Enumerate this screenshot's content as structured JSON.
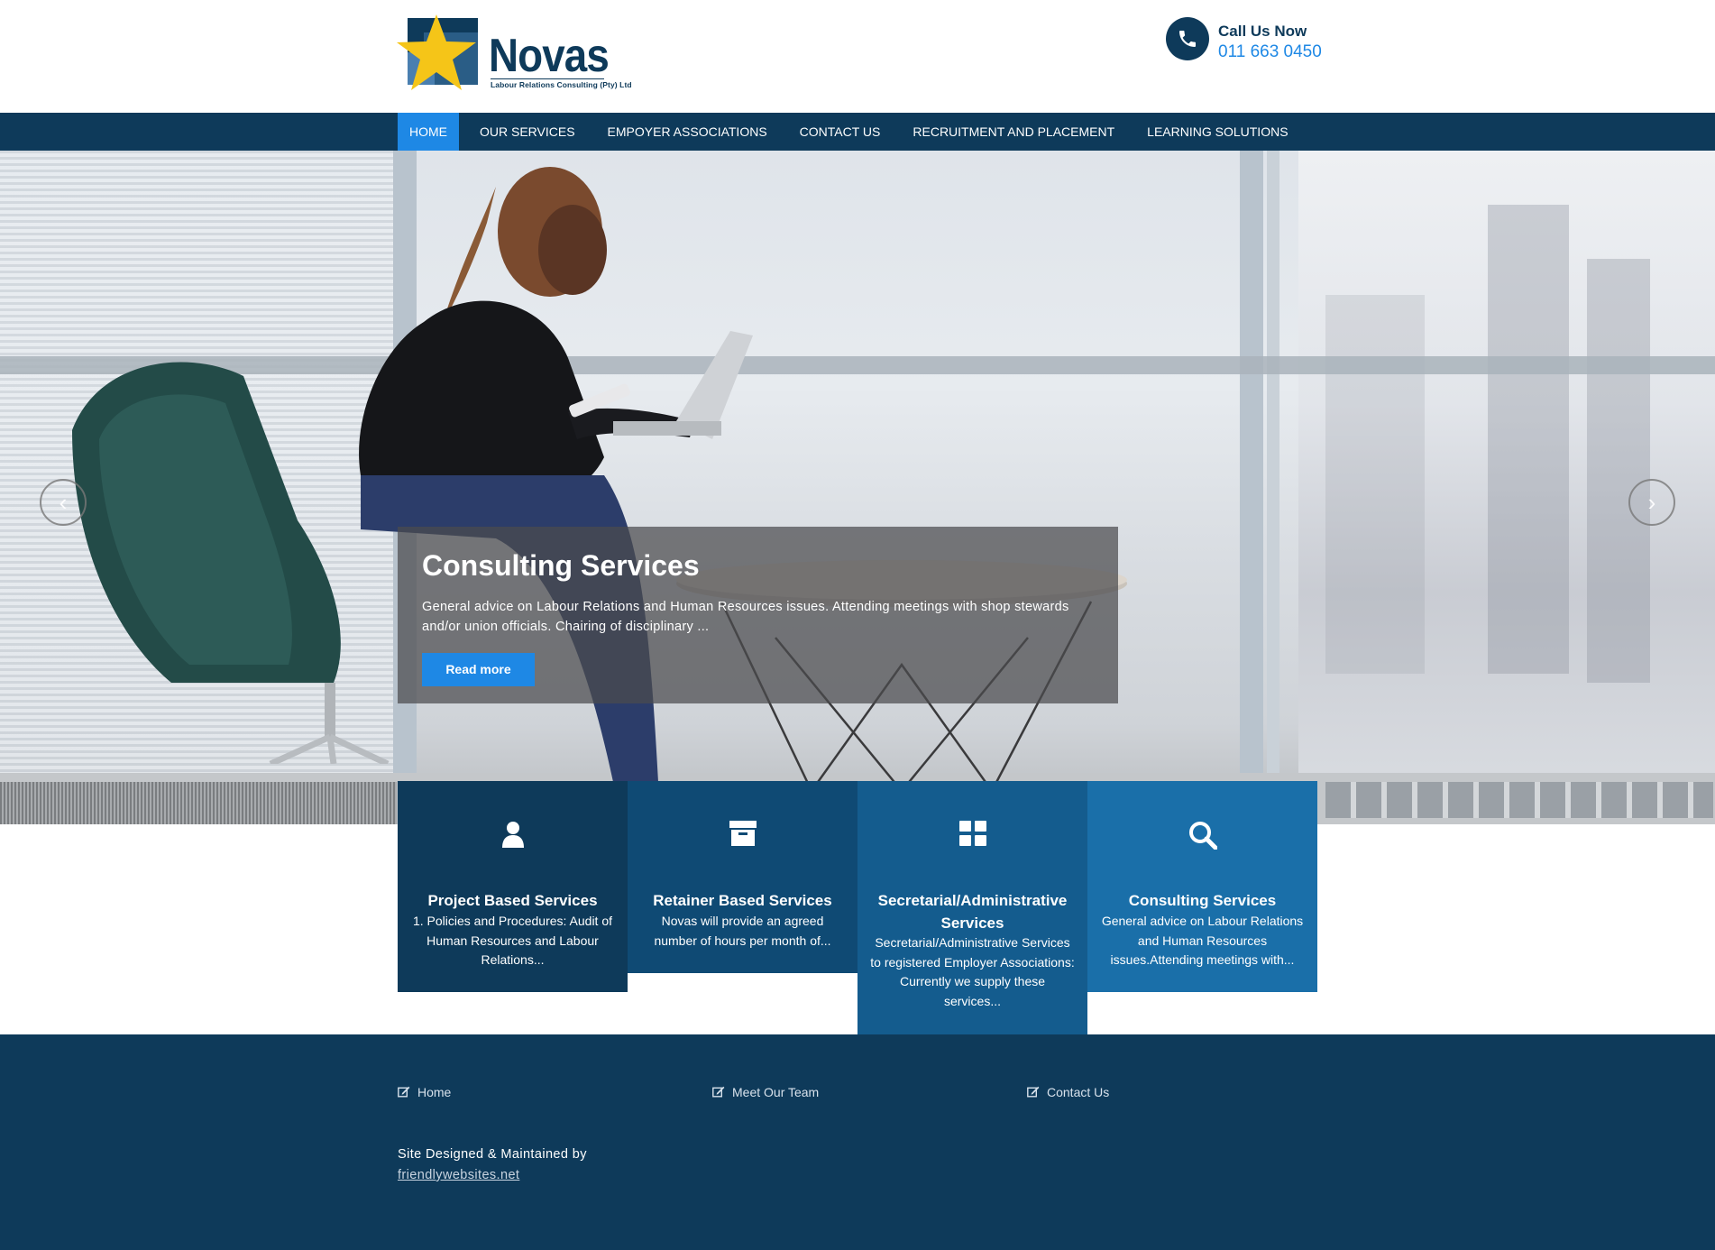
{
  "header": {
    "logo_text": "Novas",
    "logo_subtitle": "Labour Relations Consulting (Pty) Ltd",
    "call_label": "Call Us Now",
    "call_number": "011 663 0450"
  },
  "nav": {
    "items": [
      {
        "label": "HOME",
        "active": true
      },
      {
        "label": "OUR SERVICES",
        "active": false
      },
      {
        "label": "EMPOYER ASSOCIATIONS",
        "active": false
      },
      {
        "label": "CONTACT US",
        "active": false
      },
      {
        "label": "RECRUITMENT AND PLACEMENT",
        "active": false
      },
      {
        "label": "LEARNING SOLUTIONS",
        "active": false
      }
    ]
  },
  "hero": {
    "prev_icon": "chevron-left-icon",
    "next_icon": "chevron-right-icon",
    "caption_title": "Consulting Services",
    "caption_text": "General advice on Labour Relations and Human Resources issues. Attending meetings with shop stewards and/or union officials. Chairing of disciplinary ...",
    "read_more_label": "Read more"
  },
  "services": [
    {
      "icon": "user-icon",
      "color": "#0e3a5a",
      "title": "Project Based Services",
      "text": "1.  Policies and Procedures: Audit of Human Resources and Labour Relations..."
    },
    {
      "icon": "archive-icon",
      "color": "#0f4a74",
      "title": "Retainer Based Services",
      "text": "Novas will provide an agreed number of hours per month of..."
    },
    {
      "icon": "grid-icon",
      "color": "#145c8e",
      "title": "Secretarial/Administrative Services",
      "text": "Secretarial/Administrative Services to registered Employer Associations: Currently we supply these services..."
    },
    {
      "icon": "search-icon",
      "color": "#1a6fa9",
      "title": "Consulting Services",
      "text": "General advice on Labour Relations and Human Resources issues.Attending meetings with..."
    }
  ],
  "footer": {
    "links": [
      {
        "label": "Home",
        "icon": "edit-icon"
      },
      {
        "label": "Meet Our Team",
        "icon": "edit-icon"
      },
      {
        "label": "Contact Us",
        "icon": "edit-icon"
      }
    ],
    "credit_text": "Site Designed & Maintained by",
    "credit_link": "friendlywebsites.net"
  },
  "colors": {
    "brand_navy": "#0e3a5a",
    "accent_blue": "#1e88e5",
    "logo_star": "#f5c518"
  }
}
